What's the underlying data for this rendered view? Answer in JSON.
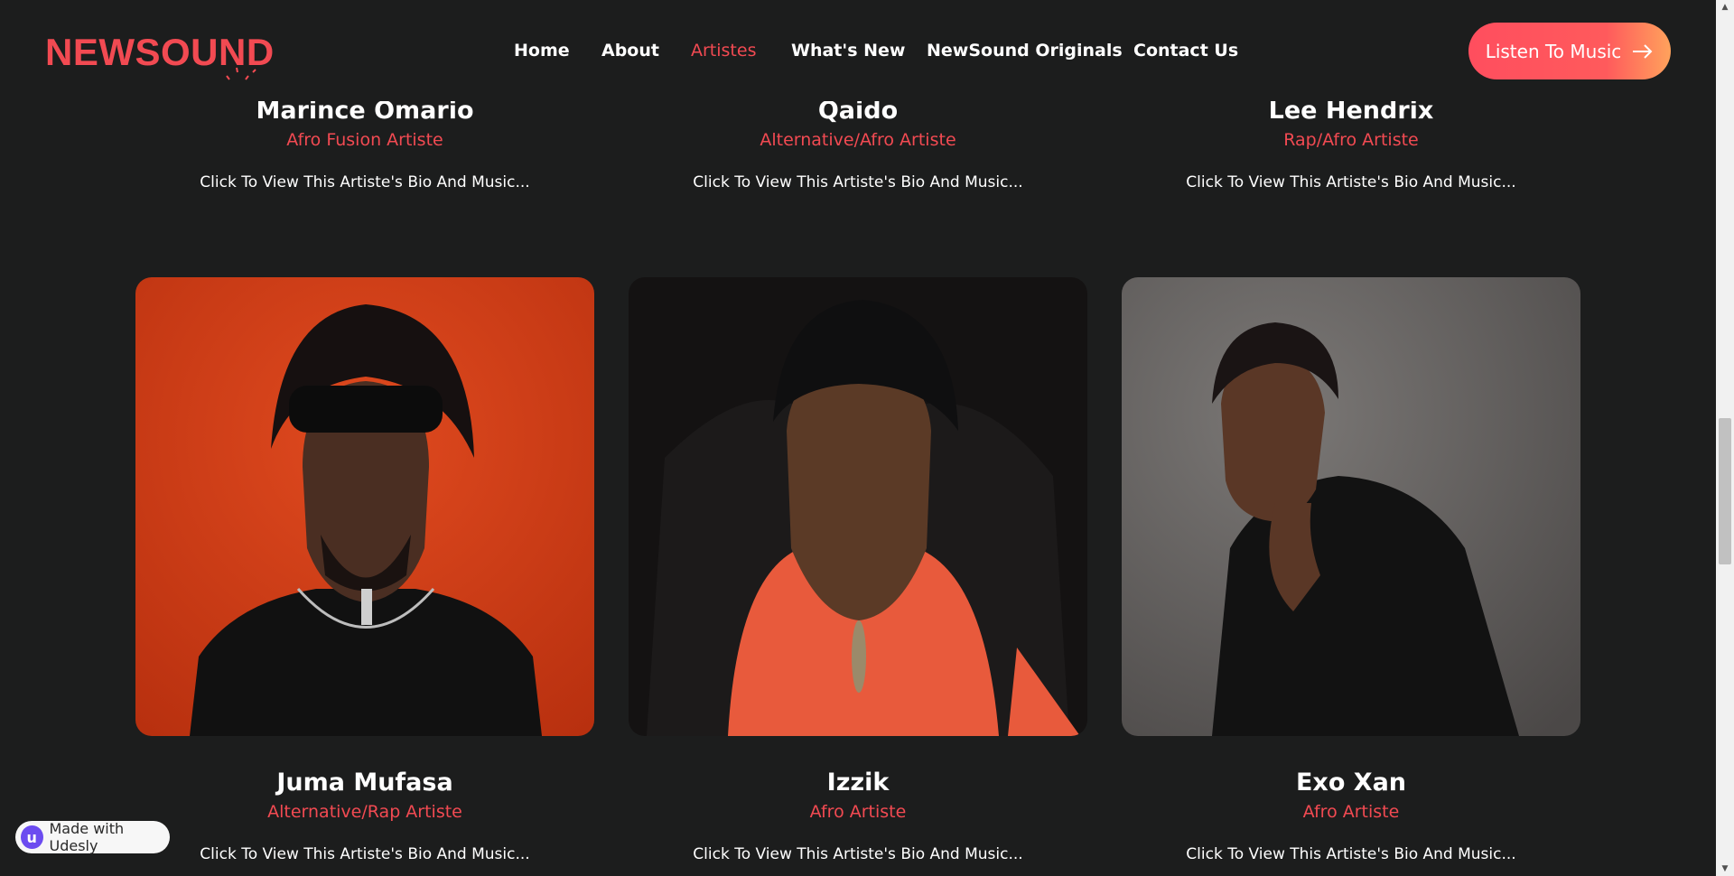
{
  "brand": {
    "logo_text": "NEWSOUND",
    "accent": "#f24a52"
  },
  "nav": {
    "items": [
      {
        "label": "Home"
      },
      {
        "label": "About"
      },
      {
        "label": "Artistes",
        "active": true
      },
      {
        "label": "What's New"
      },
      {
        "label": "NewSound Originals"
      },
      {
        "label": "Contact Us"
      }
    ],
    "cta_label": "Listen To Music"
  },
  "artists_top": [
    {
      "name": "Marince Omario",
      "genre": "Afro Fusion Artiste",
      "bio": "Click To View This Artiste's Bio And Music..."
    },
    {
      "name": "Qaido",
      "genre": "Alternative/Afro Artiste",
      "bio": "Click To View This Artiste's Bio And Music..."
    },
    {
      "name": "Lee Hendrix",
      "genre": "Rap/Afro Artiste",
      "bio": "Click To View This Artiste's Bio And Music..."
    }
  ],
  "artists": [
    {
      "name": "Juma Mufasa",
      "genre": "Alternative/Rap Artiste",
      "bio": "Click To View This Artiste's Bio And Music...",
      "photo": "portrait-orange-background"
    },
    {
      "name": "Izzik",
      "genre": "Afro Artiste",
      "bio": "Click To View This Artiste's Bio And Music...",
      "photo": "portrait-dark-background"
    },
    {
      "name": "Exo Xan",
      "genre": "Afro Artiste",
      "bio": "Click To View This Artiste's Bio And Music...",
      "photo": "portrait-grey-background"
    }
  ],
  "badge": {
    "label": "Made with Udesly",
    "icon": "udesly-icon"
  }
}
